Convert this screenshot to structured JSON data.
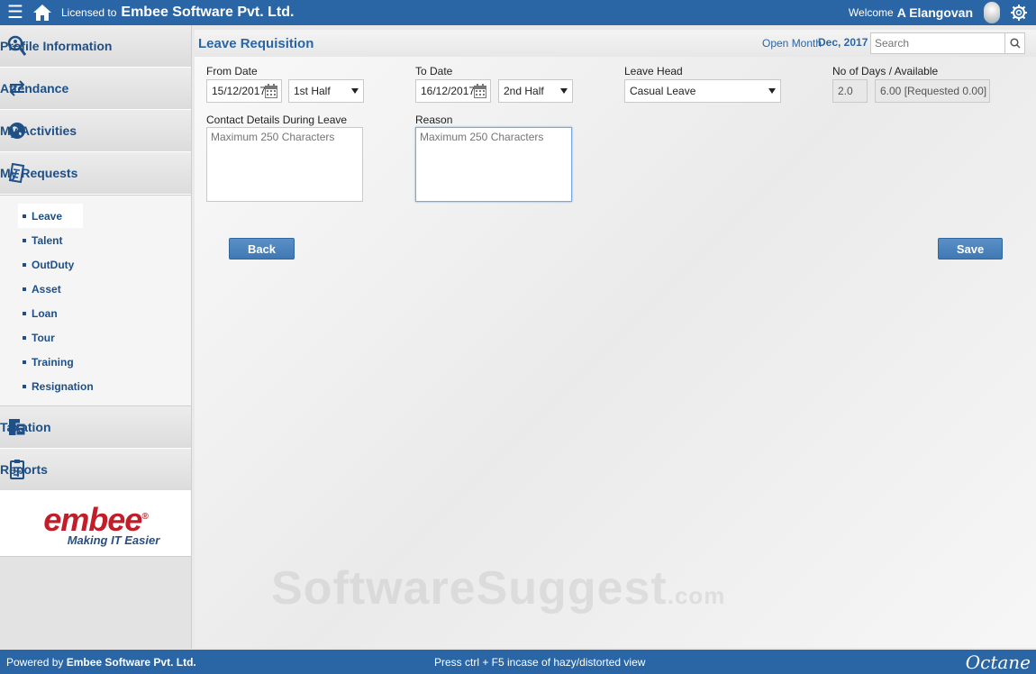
{
  "topbar": {
    "licensed_label": "Licensed to",
    "company": "Embee Software Pvt. Ltd.",
    "welcome_label": "Welcome",
    "user_name": "A Elangovan"
  },
  "sidebar": {
    "items": [
      {
        "label": "Profile Information",
        "icon": "search-person-icon"
      },
      {
        "label": "Attendance",
        "icon": "swap-arrows-icon"
      },
      {
        "label": "My Activities",
        "icon": "globe-icon"
      },
      {
        "label": "My Requests",
        "icon": "document-icon"
      }
    ],
    "sub_items": [
      "Leave",
      "Talent",
      "OutDuty",
      "Asset",
      "Loan",
      "Tour",
      "Training",
      "Resignation"
    ],
    "items_after": [
      {
        "label": "Taxation",
        "icon": "tax-icon"
      },
      {
        "label": "Reports",
        "icon": "report-icon"
      }
    ],
    "logo": {
      "word": "embee",
      "reg": "®",
      "tagline": "Making IT Easier"
    }
  },
  "main": {
    "title": "Leave Requisition",
    "open_month_label": "Open Month",
    "open_month_value": "Dec, 2017",
    "search_placeholder": "Search",
    "form": {
      "from_date_label": "From Date",
      "from_date_value": "15/12/2017",
      "from_half": "1st Half",
      "to_date_label": "To Date",
      "to_date_value": "16/12/2017",
      "to_half": "2nd Half",
      "leave_head_label": "Leave Head",
      "leave_head_value": "Casual Leave",
      "days_label": "No of Days / Available",
      "days_value": "2.0",
      "available_value": "6.00 [Requested 0.00]",
      "contact_label": "Contact Details During Leave",
      "contact_placeholder": "Maximum 250 Characters",
      "reason_label": "Reason",
      "reason_placeholder": "Maximum 250 Characters"
    },
    "back_label": "Back",
    "save_label": "Save",
    "watermark": "SoftwareSuggest",
    "watermark_suffix": ".com"
  },
  "footer": {
    "powered_label": "Powered by",
    "powered_company": "Embee Software Pvt. Ltd.",
    "hint": "Press ctrl + F5 incase of hazy/distorted view",
    "brand": "Octane"
  },
  "colors": {
    "primary": "#2a66a6",
    "logo_red": "#c21d28",
    "nav_text": "#1e4f86"
  }
}
